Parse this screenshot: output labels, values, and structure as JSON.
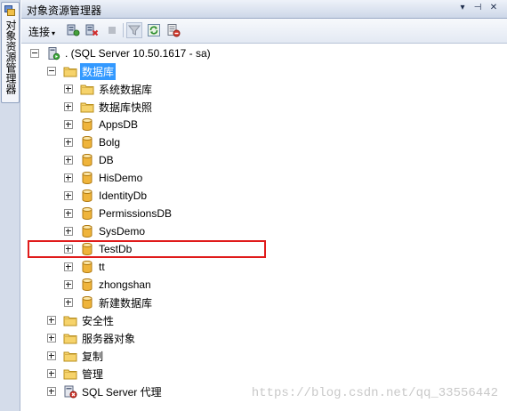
{
  "side_tab": {
    "label": "对象资源管理器"
  },
  "panel": {
    "title": "对象资源管理器",
    "controls": {
      "dropdown": "▾",
      "pin": "⊣",
      "close": "✕"
    }
  },
  "toolbar": {
    "connect_label": "连接",
    "connect_arrow": "▾"
  },
  "tree": {
    "server": ". (SQL Server 10.50.1617 - sa)",
    "databases_folder": "数据库",
    "system_databases": "系统数据库",
    "snapshots": "数据库快照",
    "databases": [
      "AppsDB",
      "Bolg",
      "DB",
      "HisDemo",
      "IdentityDb",
      "PermissionsDB",
      "SysDemo",
      "TestDb",
      "tt",
      "zhongshan",
      "新建数据库"
    ],
    "security": "安全性",
    "server_objects": "服务器对象",
    "replication": "复制",
    "management": "管理",
    "agent": "SQL Server 代理"
  },
  "highlighted_database": "TestDb",
  "watermark": "https://blog.csdn.net/qq_33556442",
  "colors": {
    "selection": "#3399ff",
    "highlight": "#e01b1b",
    "folder": "#f2c744",
    "database": "#e8a52a"
  }
}
